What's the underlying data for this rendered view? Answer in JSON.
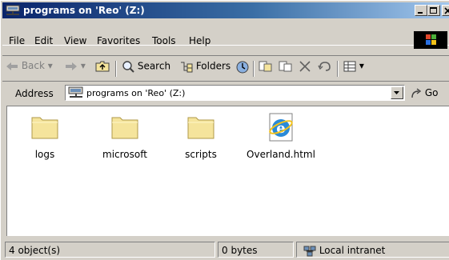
{
  "window": {
    "title": "programs on 'Reo' (Z:)"
  },
  "menu": [
    {
      "label": "File"
    },
    {
      "label": "Edit"
    },
    {
      "label": "View"
    },
    {
      "label": "Favorites"
    },
    {
      "label": "Tools"
    },
    {
      "label": "Help"
    }
  ],
  "toolbar": {
    "back_label": "Back",
    "search_label": "Search",
    "folders_label": "Folders"
  },
  "address": {
    "label": "Address",
    "value": "programs on 'Reo' (Z:)",
    "go_label": "Go"
  },
  "files": [
    {
      "name": "logs",
      "icon": "folder-icon"
    },
    {
      "name": "microsoft",
      "icon": "folder-icon"
    },
    {
      "name": "scripts",
      "icon": "folder-icon"
    },
    {
      "name": "Overland.html",
      "icon": "ie-html-file-icon"
    }
  ],
  "status": {
    "objects": "4 object(s)",
    "size": "0 bytes",
    "zone": "Local intranet"
  },
  "colors": {
    "title_start": "#0a246a",
    "title_end": "#a6caf0",
    "chrome": "#d4d0c8",
    "folder": "#f5e49c"
  }
}
